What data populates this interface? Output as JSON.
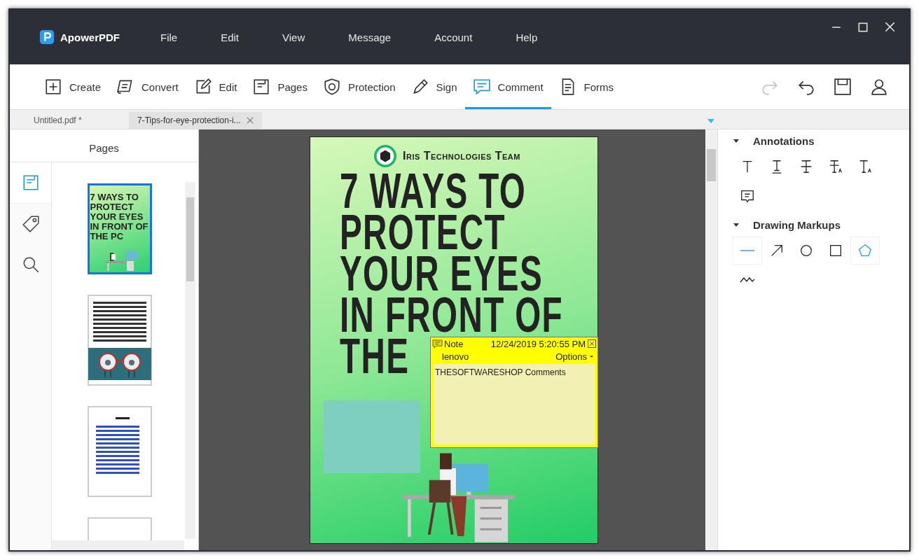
{
  "window": {
    "app_name": "ApowerPDF"
  },
  "menu": [
    "File",
    "Edit",
    "View",
    "Message",
    "Account",
    "Help"
  ],
  "toolbar": [
    {
      "label": "Create",
      "selected": false
    },
    {
      "label": "Convert",
      "selected": false
    },
    {
      "label": "Edit",
      "selected": false
    },
    {
      "label": "Pages",
      "selected": false
    },
    {
      "label": "Protection",
      "selected": false
    },
    {
      "label": "Sign",
      "selected": false
    },
    {
      "label": "Comment",
      "selected": true
    },
    {
      "label": "Forms",
      "selected": false
    }
  ],
  "actions": [
    {
      "disabled": true
    },
    {
      "disabled": false
    },
    {
      "disabled": false
    },
    {
      "disabled": false
    }
  ],
  "tabs": [
    {
      "label": "Untitled.pdf *",
      "selected": false
    },
    {
      "label": "7-Tips-for-eye-protection-i...",
      "selected": true
    }
  ],
  "left_panel": {
    "title": "Pages",
    "side_icons": [
      {
        "selected": true
      },
      {
        "selected": false
      },
      {
        "selected": false
      }
    ],
    "thumbnails": [
      {
        "kind": "cover",
        "title": "7 WAYS TO PROTECT YOUR EYES IN FRONT OF THE PC",
        "selected": true
      },
      {
        "kind": "text",
        "selected": false
      },
      {
        "kind": "list",
        "selected": false
      },
      {
        "kind": "blank",
        "selected": false
      }
    ]
  },
  "document": {
    "brand": "Iris Technologies Team",
    "title_lines": [
      "7 WAYS TO",
      "PROTECT",
      "YOUR EYES",
      "IN FRONT OF",
      "THE"
    ]
  },
  "note": {
    "label": "Note",
    "date": "12/24/2019 5:20:55 PM",
    "author": "lenovo",
    "options": "Options",
    "text": "THESOFTWARESHOP Comments"
  },
  "right_panel": {
    "sections": [
      {
        "title": "Annotations",
        "expanded": true,
        "tools": [
          {
            "selected": false
          },
          {
            "selected": false
          },
          {
            "selected": false
          },
          {
            "selected": false
          },
          {
            "selected": false
          },
          {
            "selected": false
          }
        ]
      },
      {
        "title": "Drawing Markups",
        "expanded": true,
        "tools": [
          {
            "selected": true
          },
          {
            "selected": false
          },
          {
            "selected": false
          },
          {
            "selected": false
          },
          {
            "selected": true
          },
          {
            "selected": false
          }
        ]
      }
    ]
  }
}
